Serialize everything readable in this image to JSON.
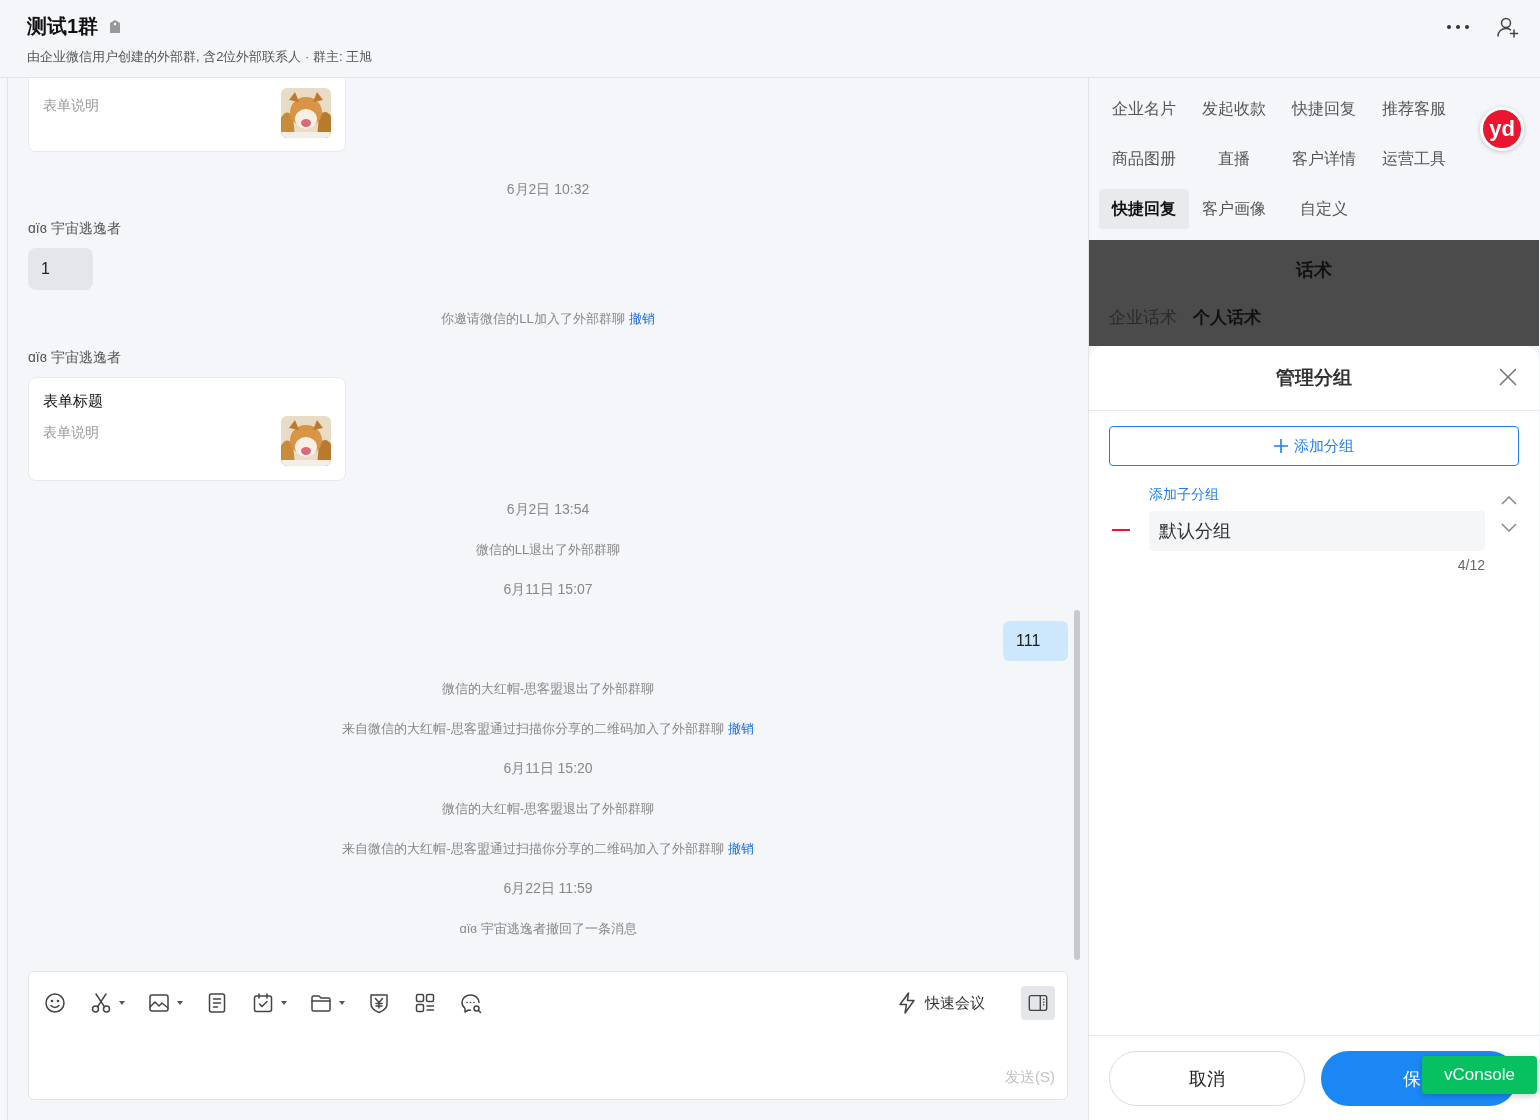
{
  "header": {
    "title": "测试1群",
    "subtitle": "由企业微信用户创建的外部群, 含2位外部联系人 · 群主: 王旭"
  },
  "messages": [
    {
      "kind": "card_partial",
      "description": "表单说明"
    },
    {
      "kind": "time",
      "text": "6月2日 10:32"
    },
    {
      "kind": "sender",
      "text": "ɑïɞ 宇宙逃逸者"
    },
    {
      "kind": "incoming",
      "text": "1"
    },
    {
      "kind": "system",
      "text": "你邀请微信的LL加入了外部群聊",
      "link": "撤销"
    },
    {
      "kind": "sender",
      "text": "ɑïɞ 宇宙逃逸者"
    },
    {
      "kind": "card",
      "title": "表单标题",
      "description": "表单说明"
    },
    {
      "kind": "time",
      "text": "6月2日 13:54"
    },
    {
      "kind": "system",
      "text": "微信的LL退出了外部群聊"
    },
    {
      "kind": "time",
      "text": "6月11日 15:07"
    },
    {
      "kind": "outgoing",
      "text": "111"
    },
    {
      "kind": "system",
      "text": "微信的大红帽-思客盟退出了外部群聊"
    },
    {
      "kind": "system",
      "text": "来自微信的大红帽-思客盟通过扫描你分享的二维码加入了外部群聊",
      "link": "撤销"
    },
    {
      "kind": "time",
      "text": "6月11日 15:20"
    },
    {
      "kind": "system",
      "text": "微信的大红帽-思客盟退出了外部群聊"
    },
    {
      "kind": "system",
      "text": "来自微信的大红帽-思客盟通过扫描你分享的二维码加入了外部群聊",
      "link": "撤销"
    },
    {
      "kind": "time",
      "text": "6月22日 11:59"
    },
    {
      "kind": "system",
      "text": "ɑïɞ 宇宙逃逸者撤回了一条消息"
    }
  ],
  "composer": {
    "quick_meeting": "快速会议",
    "send": "发送(S)"
  },
  "panel": {
    "tabs": [
      {
        "label": "企业名片",
        "selected": false
      },
      {
        "label": "发起收款",
        "selected": false
      },
      {
        "label": "快捷回复",
        "selected": false
      },
      {
        "label": "推荐客服",
        "selected": false
      },
      {
        "label": "商品图册",
        "selected": false
      },
      {
        "label": "直播",
        "selected": false
      },
      {
        "label": "客户详情",
        "selected": false
      },
      {
        "label": "运营工具",
        "selected": false
      },
      {
        "label": "快捷回复",
        "selected": true
      },
      {
        "label": "客户画像",
        "selected": false
      },
      {
        "label": "自定义",
        "selected": false
      }
    ],
    "badge": "yd",
    "sheet_title": "话术",
    "script_tabs": [
      {
        "label": "企业话术",
        "selected": false
      },
      {
        "label": "个人话术",
        "selected": true
      }
    ],
    "dialog": {
      "title": "管理分组",
      "add_button": "添加分组",
      "subgroup_link": "添加子分组",
      "group_value": "默认分组",
      "counter": "4/12",
      "cancel": "取消",
      "save": "保"
    }
  },
  "vconsole": "vConsole"
}
